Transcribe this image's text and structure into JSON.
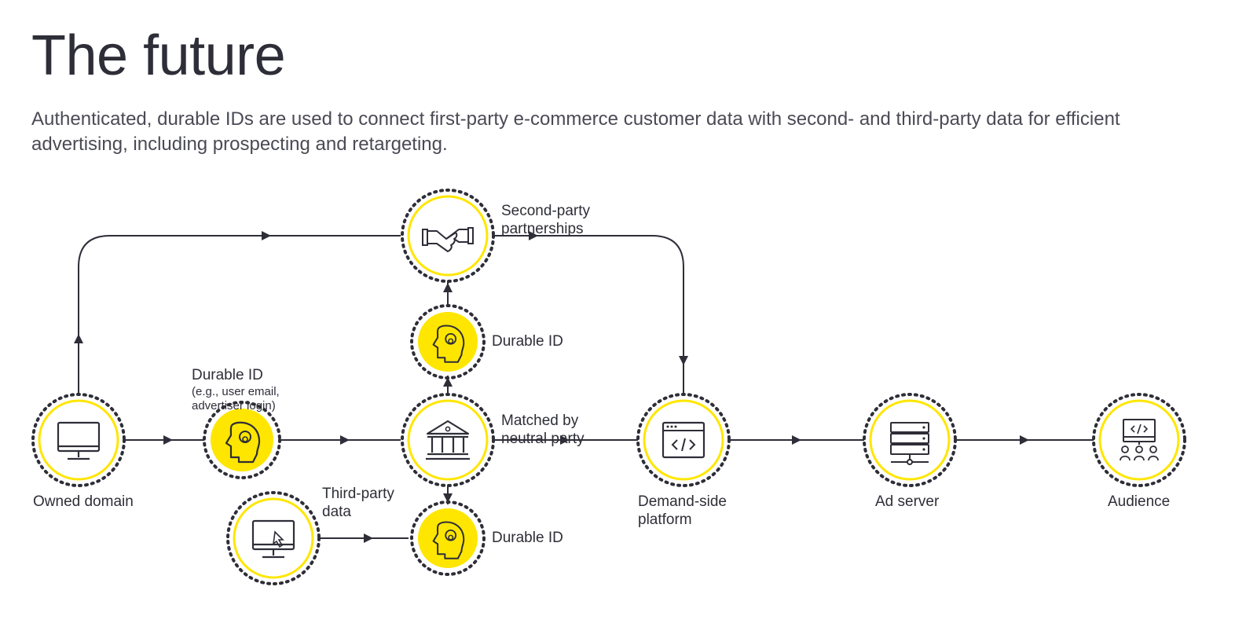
{
  "title": "The future",
  "subtitle": "Authenticated, durable IDs are used to connect first-party e-commerce customer data with second- and third-party data for efficient advertising, including prospecting and retargeting.",
  "colors": {
    "yellow": "#ffe600",
    "ink": "#2e2e38"
  },
  "nodes": {
    "owned_domain": {
      "label": "Owned domain",
      "icon": "monitor"
    },
    "durable_id_main": {
      "label": "Durable ID",
      "sublabel": "(e.g., user email, advertiser login)",
      "icon": "head"
    },
    "neutral_party": {
      "label": "Matched by neutral party",
      "icon": "institution"
    },
    "durable_id_top": {
      "label": "Durable ID",
      "icon": "head"
    },
    "durable_id_bottom": {
      "label": "Durable ID",
      "icon": "head"
    },
    "second_party": {
      "label": "Second-party partnerships",
      "icon": "handshake"
    },
    "third_party": {
      "label": "Third-party data",
      "icon": "monitor-cursor"
    },
    "dsp": {
      "label": "Demand-side platform",
      "icon": "browser-code"
    },
    "ad_server": {
      "label": "Ad server",
      "icon": "server"
    },
    "audience": {
      "label": "Audience",
      "icon": "audience"
    }
  }
}
